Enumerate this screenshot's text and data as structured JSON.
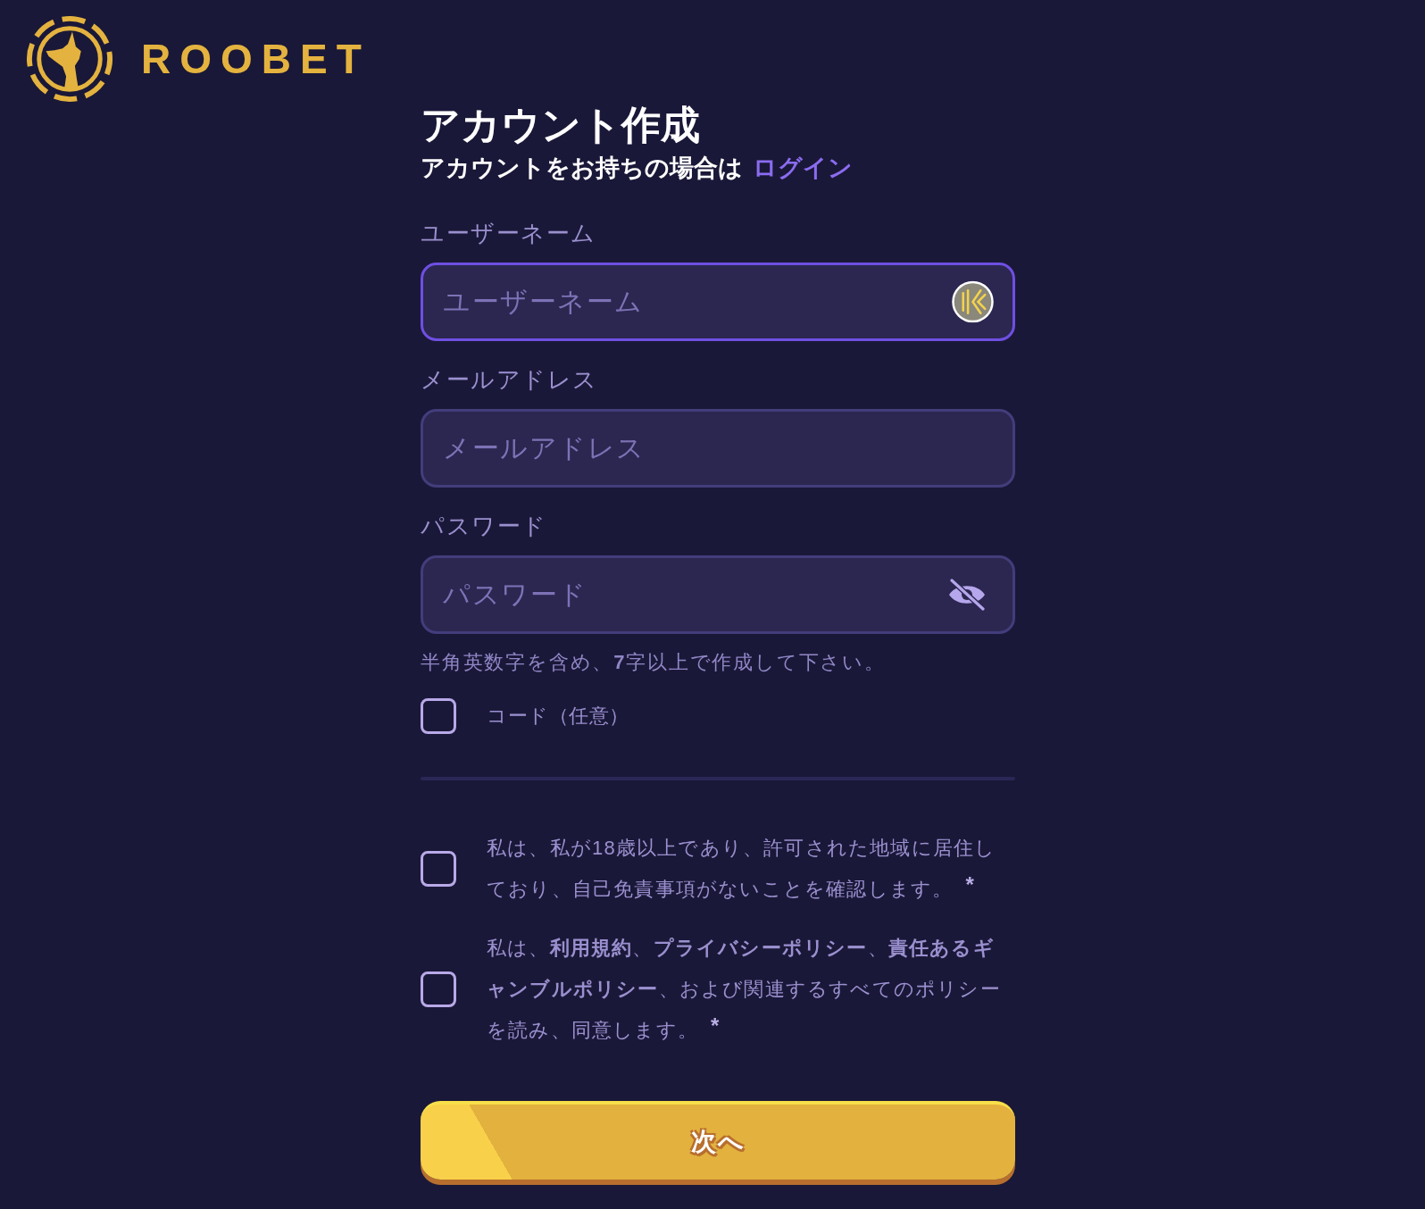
{
  "logo": {
    "wordmark": "ROOBET"
  },
  "form": {
    "title": "アカウント作成",
    "subtitle": {
      "text": "アカウントをお持ちの場合は",
      "link": "ログイン"
    }
  },
  "fields": [
    {
      "kind": "username",
      "label": "ユーザーネーム",
      "placeholder": "ユーザーネーム",
      "focused": true
    },
    {
      "kind": "email",
      "label": "メールアドレス",
      "placeholder": "メールアドレス",
      "focused": false
    },
    {
      "kind": "password",
      "label": "パスワード",
      "placeholder": "パスワード",
      "focused": false
    }
  ],
  "password_hint": "半角英数字を含め、**7**字以上で作成して下さい。",
  "code_option": {
    "label": "コード（任意）",
    "checked": false
  },
  "agreements": [
    {
      "text": "私は、私が18歳以上であり、許可された地域に居住しており、自己免責事項がないことを確認します。",
      "required_mark": "*",
      "checked": false
    },
    {
      "text": "私は、**利用規約**、**プライバシーポリシー**、**責任あるギャンブルポリシー**、および関連するすべてのポリシーを読み、同意します。",
      "required_mark": "*",
      "checked": false
    }
  ],
  "next_button": {
    "label": "次へ"
  }
}
